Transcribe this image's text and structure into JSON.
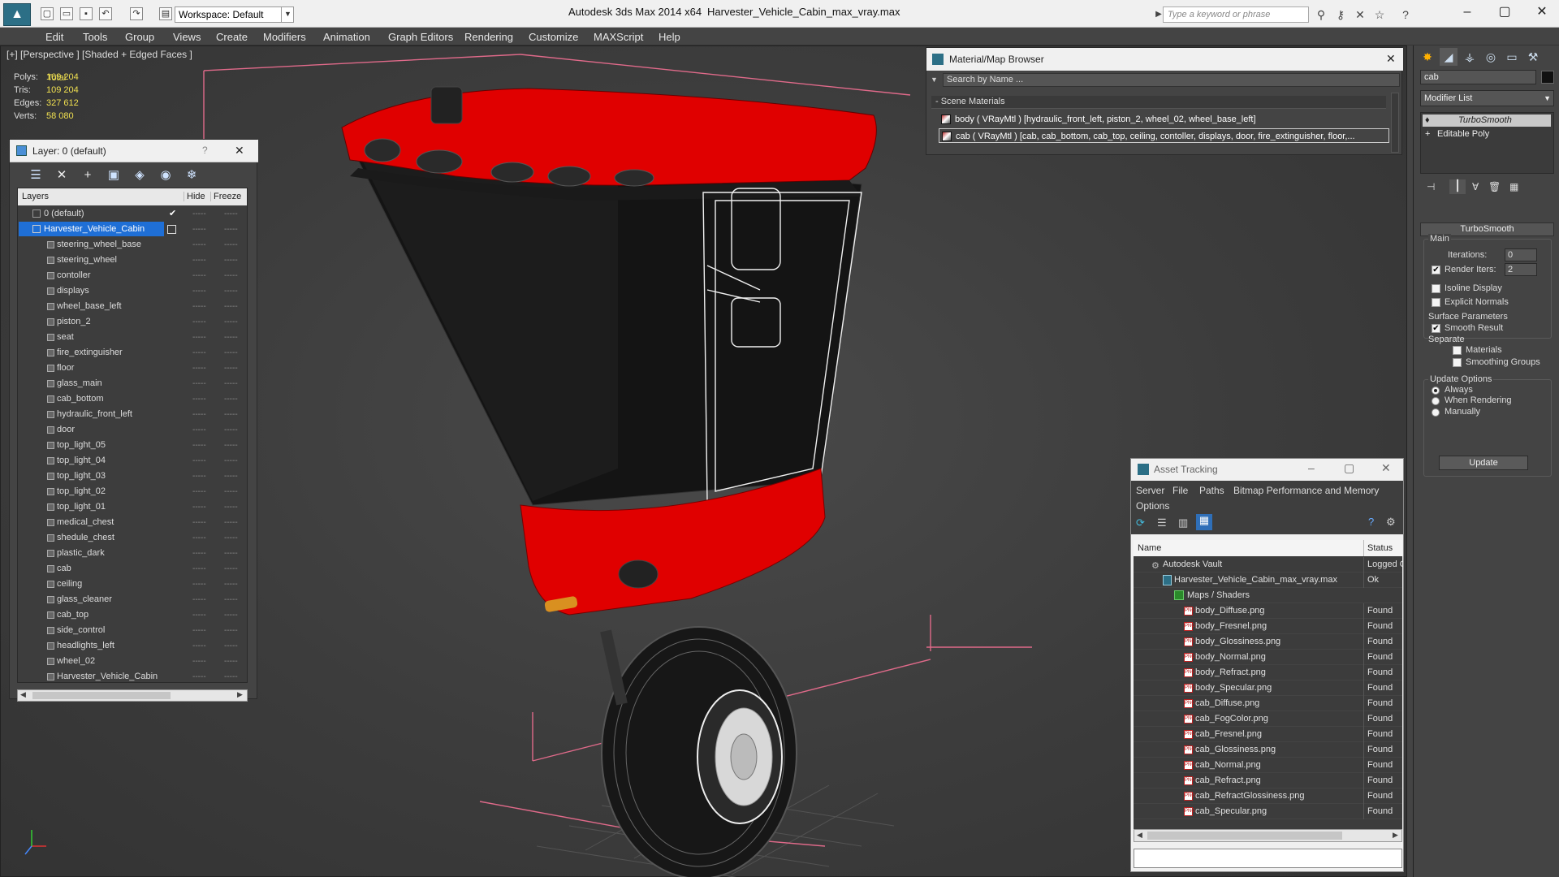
{
  "titlebar": {
    "app_title": "Autodesk 3ds Max  2014 x64",
    "file_title": "Harvester_Vehicle_Cabin_max_vray.max",
    "workspace": "Workspace: Default",
    "search_placeholder": "Type a keyword or phrase"
  },
  "menus": [
    "Edit",
    "Tools",
    "Group",
    "Views",
    "Create",
    "Modifiers",
    "Animation",
    "Graph Editors",
    "Rendering",
    "Customize",
    "MAXScript",
    "Help"
  ],
  "viewport": {
    "label": "[+] [Perspective ] [Shaded + Edged Faces ]",
    "stats_total": "Total",
    "stats": [
      {
        "label": "Polys:",
        "value": "109 204"
      },
      {
        "label": "Tris:",
        "value": "109 204"
      },
      {
        "label": "Edges:",
        "value": "327 612"
      },
      {
        "label": "Verts:",
        "value": "58 080"
      }
    ]
  },
  "layer_panel": {
    "title": "Layer: 0 (default)",
    "help": "?",
    "close": "✕",
    "col_layers": "Layers",
    "col_hide": "Hide",
    "col_freeze": "Freeze",
    "default_layer": "0 (default)",
    "selected_layer": "Harvester_Vehicle_Cabin",
    "objects": [
      "steering_wheel_base",
      "steering_wheel",
      "contoller",
      "displays",
      "wheel_base_left",
      "piston_2",
      "seat",
      "fire_extinguisher",
      "floor",
      "glass_main",
      "cab_bottom",
      "hydraulic_front_left",
      "door",
      "top_light_05",
      "top_light_04",
      "top_light_03",
      "top_light_02",
      "top_light_01",
      "medical_chest",
      "shedule_chest",
      "plastic_dark",
      "cab",
      "ceiling",
      "glass_cleaner",
      "cab_top",
      "side_control",
      "headlights_left",
      "wheel_02",
      "Harvester_Vehicle_Cabin"
    ],
    "dash": "-----"
  },
  "material_browser": {
    "title": "Material/Map Browser",
    "search_placeholder": "Search by Name ...",
    "section": "- Scene Materials",
    "materials": [
      "body  ( VRayMtl ) [hydraulic_front_left, piston_2, wheel_02, wheel_base_left]",
      "cab  ( VRayMtl ) [cab, cab_bottom, cab_top, ceiling, contoller, displays, door, fire_extinguisher, floor,..."
    ]
  },
  "command_panel": {
    "object_name": "cab",
    "modifier_list": "Modifier List",
    "stack": [
      "TurboSmooth",
      "Editable Poly"
    ],
    "rollout_title": "TurboSmooth",
    "main_label": "Main",
    "iterations_label": "Iterations:",
    "iterations_value": "0",
    "render_iters_label": "Render Iters:",
    "render_iters_value": "2",
    "render_iters_checked": true,
    "isoline_label": "Isoline Display",
    "explicit_normals_label": "Explicit Normals",
    "surface_params_label": "Surface Parameters",
    "smooth_result_label": "Smooth Result",
    "separate_label": "Separate",
    "materials_label": "Materials",
    "smoothing_groups_label": "Smoothing Groups",
    "update_options_label": "Update Options",
    "update_always": "Always",
    "update_when_rendering": "When Rendering",
    "update_manually": "Manually",
    "update_button": "Update"
  },
  "asset_tracking": {
    "title": "Asset Tracking",
    "menu": [
      "Server",
      "File",
      "Paths",
      "Bitmap Performance and Memory",
      "Options"
    ],
    "col_name": "Name",
    "col_status": "Status",
    "vault": {
      "name": "Autodesk Vault",
      "status": "Logged Out"
    },
    "file": {
      "name": "Harvester_Vehicle_Cabin_max_vray.max",
      "status": "Ok"
    },
    "maps_folder": "Maps / Shaders",
    "maps": [
      {
        "name": "body_Diffuse.png",
        "status": "Found"
      },
      {
        "name": "body_Fresnel.png",
        "status": "Found"
      },
      {
        "name": "body_Glossiness.png",
        "status": "Found"
      },
      {
        "name": "body_Normal.png",
        "status": "Found"
      },
      {
        "name": "body_Refract.png",
        "status": "Found"
      },
      {
        "name": "body_Specular.png",
        "status": "Found"
      },
      {
        "name": "cab_Diffuse.png",
        "status": "Found"
      },
      {
        "name": "cab_FogColor.png",
        "status": "Found"
      },
      {
        "name": "cab_Fresnel.png",
        "status": "Found"
      },
      {
        "name": "cab_Glossiness.png",
        "status": "Found"
      },
      {
        "name": "cab_Normal.png",
        "status": "Found"
      },
      {
        "name": "cab_Refract.png",
        "status": "Found"
      },
      {
        "name": "cab_RefractGlossiness.png",
        "status": "Found"
      },
      {
        "name": "cab_Specular.png",
        "status": "Found"
      }
    ]
  },
  "colors": {
    "cab_red": "#e00000",
    "selection_blue": "#1f6fd6",
    "stats_yellow": "#f0e050"
  }
}
